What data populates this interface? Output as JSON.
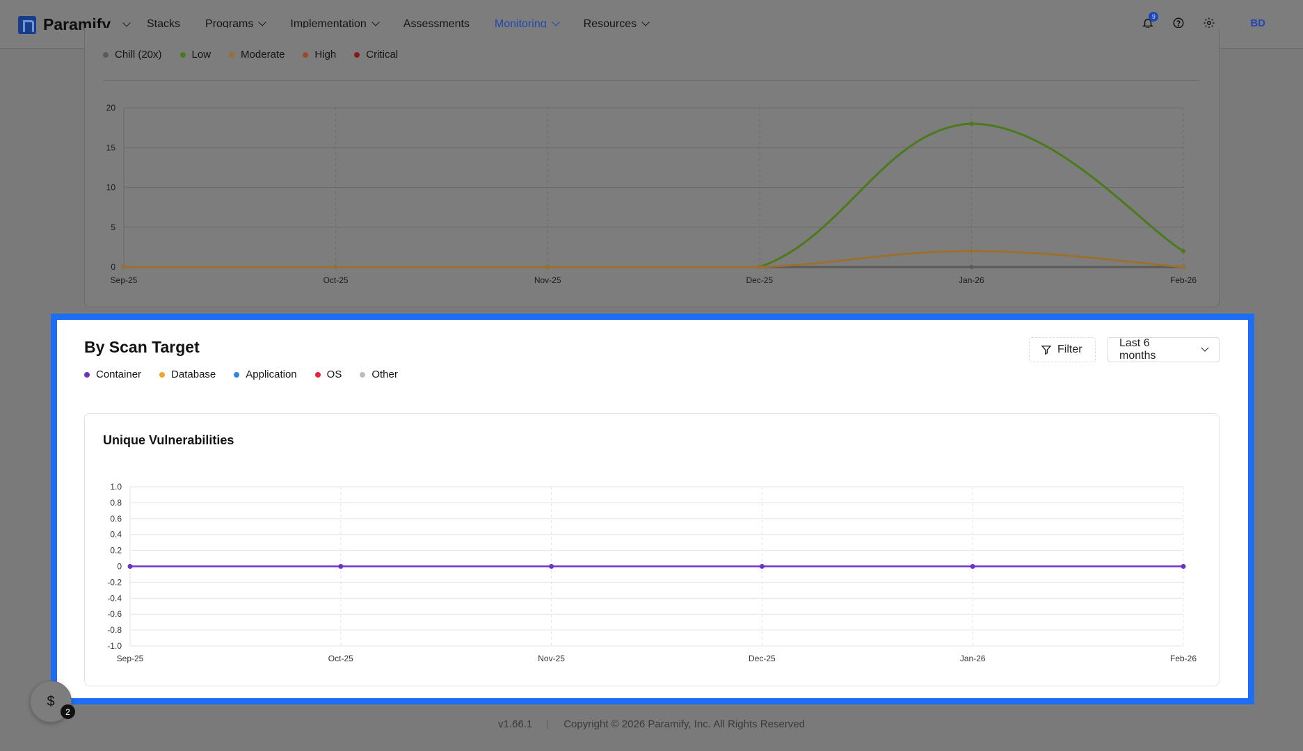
{
  "app": {
    "name": "Paramify"
  },
  "nav": {
    "items": [
      {
        "label": "Stacks",
        "dropdown": false,
        "active": false
      },
      {
        "label": "Programs",
        "dropdown": true,
        "active": false
      },
      {
        "label": "Implementation",
        "dropdown": true,
        "active": false
      },
      {
        "label": "Assessments",
        "dropdown": false,
        "active": false
      },
      {
        "label": "Monitoring",
        "dropdown": true,
        "active": true
      },
      {
        "label": "Resources",
        "dropdown": true,
        "active": false
      }
    ],
    "notification_count": "9",
    "avatar_initials": "BD",
    "icons": [
      "bell-icon",
      "help-circle-icon",
      "gear-icon"
    ]
  },
  "severity_legend": [
    {
      "label": "Chill (20x)",
      "color": "#5a5a5a"
    },
    {
      "label": "Low",
      "color": "#4a7a1a"
    },
    {
      "label": "Moderate",
      "color": "#9a7030"
    },
    {
      "label": "High",
      "color": "#9a4a2a"
    },
    {
      "label": "Critical",
      "color": "#8a1a1a"
    }
  ],
  "scan_target": {
    "title": "By Scan Target",
    "filter_label": "Filter",
    "range_label": "Last 6 months",
    "legend": [
      {
        "label": "Container",
        "color": "#6d33c9"
      },
      {
        "label": "Database",
        "color": "#f2a624"
      },
      {
        "label": "Application",
        "color": "#2b86e8"
      },
      {
        "label": "OS",
        "color": "#e8223a"
      },
      {
        "label": "Other",
        "color": "#bdbdbd"
      }
    ],
    "chart_title": "Unique Vulnerabilities"
  },
  "footer": {
    "version": "v1.66.1",
    "copyright": "Copyright © 2026 Paramify, Inc. All Rights Reserved"
  },
  "help_widget": {
    "badge": "2"
  },
  "chart_data": [
    {
      "type": "line",
      "title": "",
      "categories": [
        "Sep-25",
        "Oct-25",
        "Nov-25",
        "Dec-25",
        "Jan-26",
        "Feb-26"
      ],
      "ylim": [
        0,
        20
      ],
      "yticks": [
        0,
        5,
        10,
        15,
        20
      ],
      "series": [
        {
          "name": "Chill (20x)",
          "color": "#5a5a5a",
          "values": [
            0,
            0,
            0,
            0,
            0,
            0
          ]
        },
        {
          "name": "Low",
          "color": "#4a7a1a",
          "values": [
            0,
            0,
            0,
            0,
            18,
            2
          ]
        },
        {
          "name": "Moderate",
          "color": "#9a7030",
          "values": [
            0,
            0,
            0,
            0,
            2,
            0
          ]
        },
        {
          "name": "High",
          "color": "#9a4a2a",
          "values": [
            0,
            0,
            0,
            0,
            0,
            0
          ]
        },
        {
          "name": "Critical",
          "color": "#8a1a1a",
          "values": [
            0,
            0,
            0,
            0,
            0,
            0
          ]
        }
      ],
      "grid": true,
      "legend": "top-left"
    },
    {
      "type": "line",
      "title": "Unique Vulnerabilities",
      "categories": [
        "Sep-25",
        "Oct-25",
        "Nov-25",
        "Dec-25",
        "Jan-26",
        "Feb-26"
      ],
      "ylim": [
        -1.0,
        1.0
      ],
      "yticks": [
        "1.0",
        "0.8",
        "0.6",
        "0.4",
        "0.2",
        "0",
        "-0.2",
        "-0.4",
        "-0.6",
        "-0.8",
        "-1.0"
      ],
      "series": [
        {
          "name": "Container",
          "color": "#6d33c9",
          "values": [
            0,
            0,
            0,
            0,
            0,
            0
          ]
        }
      ],
      "grid": true,
      "legend": "top-left"
    }
  ]
}
